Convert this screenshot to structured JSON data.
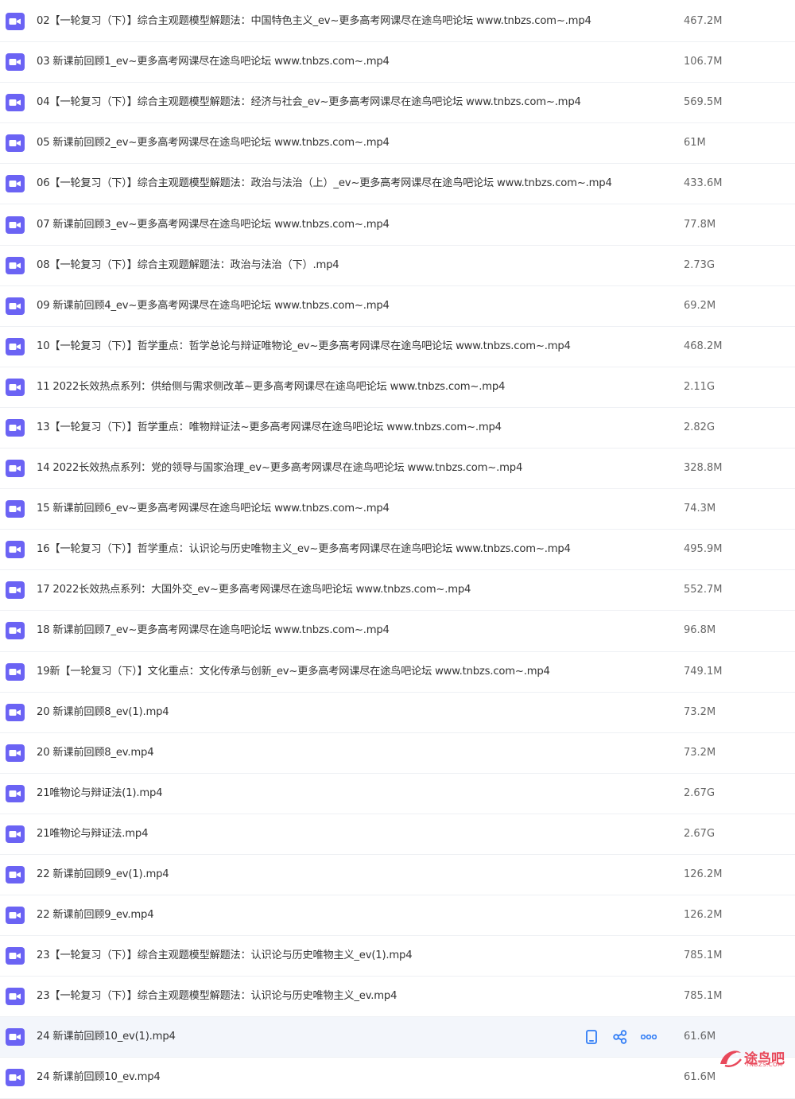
{
  "colors": {
    "icon_purple": "#6b63f4",
    "action_blue": "#2f7cf6",
    "row_border": "#eef0f4",
    "highlight_row": "#f3f6fb",
    "watermark_red": "#e8485a"
  },
  "icons": {
    "file_type": "video-camera-icon",
    "row_actions": [
      "phone-icon",
      "share-icon",
      "more-icon"
    ]
  },
  "files": [
    {
      "name": "02【一轮复习（下）】综合主观题模型解题法：中国特色主义_ev~更多高考网课尽在途鸟吧论坛 www.tnbzs.com~.mp4",
      "size": "467.2M"
    },
    {
      "name": "03 新课前回顾1_ev~更多高考网课尽在途鸟吧论坛 www.tnbzs.com~.mp4",
      "size": "106.7M"
    },
    {
      "name": "04【一轮复习（下）】综合主观题模型解题法：经济与社会_ev~更多高考网课尽在途鸟吧论坛 www.tnbzs.com~.mp4",
      "size": "569.5M"
    },
    {
      "name": "05 新课前回顾2_ev~更多高考网课尽在途鸟吧论坛 www.tnbzs.com~.mp4",
      "size": "61M"
    },
    {
      "name": "06【一轮复习（下）】综合主观题模型解题法：政治与法治（上）_ev~更多高考网课尽在途鸟吧论坛 www.tnbzs.com~.mp4",
      "size": "433.6M"
    },
    {
      "name": "07 新课前回顾3_ev~更多高考网课尽在途鸟吧论坛 www.tnbzs.com~.mp4",
      "size": "77.8M"
    },
    {
      "name": "08【一轮复习（下）】综合主观题解题法：政治与法治（下）.mp4",
      "size": "2.73G"
    },
    {
      "name": "09 新课前回顾4_ev~更多高考网课尽在途鸟吧论坛 www.tnbzs.com~.mp4",
      "size": "69.2M"
    },
    {
      "name": "10【一轮复习（下）】哲学重点：哲学总论与辩证唯物论_ev~更多高考网课尽在途鸟吧论坛 www.tnbzs.com~.mp4",
      "size": "468.2M"
    },
    {
      "name": "11 2022长效热点系列：供给侧与需求侧改革~更多高考网课尽在途鸟吧论坛 www.tnbzs.com~.mp4",
      "size": "2.11G"
    },
    {
      "name": "13【一轮复习（下）】哲学重点：唯物辩证法~更多高考网课尽在途鸟吧论坛 www.tnbzs.com~.mp4",
      "size": "2.82G"
    },
    {
      "name": "14 2022长效热点系列：党的领导与国家治理_ev~更多高考网课尽在途鸟吧论坛 www.tnbzs.com~.mp4",
      "size": "328.8M"
    },
    {
      "name": "15 新课前回顾6_ev~更多高考网课尽在途鸟吧论坛 www.tnbzs.com~.mp4",
      "size": "74.3M"
    },
    {
      "name": "16【一轮复习（下）】哲学重点：认识论与历史唯物主义_ev~更多高考网课尽在途鸟吧论坛 www.tnbzs.com~.mp4",
      "size": "495.9M"
    },
    {
      "name": "17 2022长效热点系列：大国外交_ev~更多高考网课尽在途鸟吧论坛 www.tnbzs.com~.mp4",
      "size": "552.7M"
    },
    {
      "name": "18 新课前回顾7_ev~更多高考网课尽在途鸟吧论坛 www.tnbzs.com~.mp4",
      "size": "96.8M"
    },
    {
      "name": "19新【一轮复习（下）】文化重点：文化传承与创新_ev~更多高考网课尽在途鸟吧论坛 www.tnbzs.com~.mp4",
      "size": "749.1M"
    },
    {
      "name": "20 新课前回顾8_ev(1).mp4",
      "size": "73.2M"
    },
    {
      "name": "20 新课前回顾8_ev.mp4",
      "size": "73.2M"
    },
    {
      "name": "21唯物论与辩证法(1).mp4",
      "size": "2.67G"
    },
    {
      "name": "21唯物论与辩证法.mp4",
      "size": "2.67G"
    },
    {
      "name": "22 新课前回顾9_ev(1).mp4",
      "size": "126.2M"
    },
    {
      "name": "22 新课前回顾9_ev.mp4",
      "size": "126.2M"
    },
    {
      "name": "23【一轮复习（下）】综合主观题模型解题法：认识论与历史唯物主义_ev(1).mp4",
      "size": "785.1M"
    },
    {
      "name": "23【一轮复习（下）】综合主观题模型解题法：认识论与历史唯物主义_ev.mp4",
      "size": "785.1M"
    },
    {
      "name": "24 新课前回顾10_ev(1).mp4",
      "size": "61.6M",
      "hovered": true
    },
    {
      "name": "24 新课前回顾10_ev.mp4",
      "size": "61.6M"
    }
  ],
  "watermark": {
    "text": "途鸟吧",
    "sub": "TNBZS.COM"
  }
}
